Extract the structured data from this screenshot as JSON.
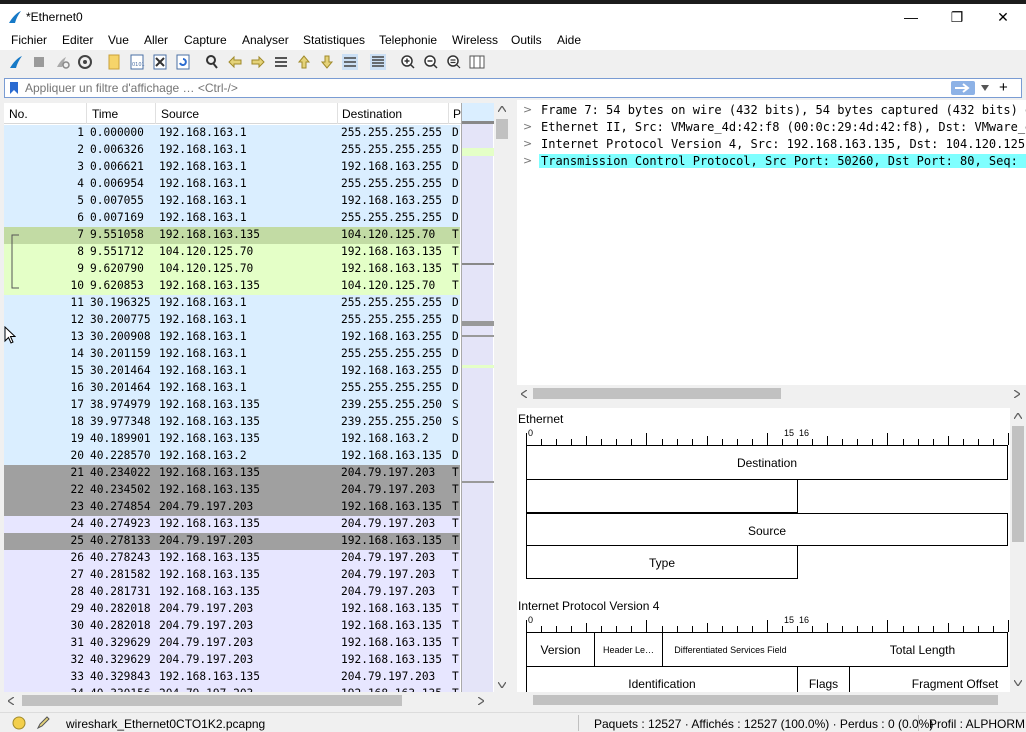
{
  "window": {
    "title": "*Ethernet0",
    "minimize": "—",
    "restore": "❐",
    "close": "✕"
  },
  "menu": [
    "Fichier",
    "Editer",
    "Vue",
    "Aller",
    "Capture",
    "Analyser",
    "Statistiques",
    "Telephonie",
    "Wireless",
    "Outils",
    "Aide"
  ],
  "filter": {
    "placeholder": "Appliquer un filtre d'affichage … <Ctrl-/>",
    "add": "+"
  },
  "columns": {
    "no": "No.",
    "time": "Time",
    "source": "Source",
    "destination": "Destination",
    "protocol": "P"
  },
  "packets": [
    {
      "no": "1",
      "time": "0.000000",
      "src": "192.168.163.1",
      "dst": "255.255.255.255",
      "proto": "D",
      "color": "#daeeff"
    },
    {
      "no": "2",
      "time": "0.006326",
      "src": "192.168.163.1",
      "dst": "255.255.255.255",
      "proto": "D",
      "color": "#daeeff"
    },
    {
      "no": "3",
      "time": "0.006621",
      "src": "192.168.163.1",
      "dst": "192.168.163.255",
      "proto": "D",
      "color": "#daeeff"
    },
    {
      "no": "4",
      "time": "0.006954",
      "src": "192.168.163.1",
      "dst": "255.255.255.255",
      "proto": "D",
      "color": "#daeeff"
    },
    {
      "no": "5",
      "time": "0.007055",
      "src": "192.168.163.1",
      "dst": "192.168.163.255",
      "proto": "D",
      "color": "#daeeff"
    },
    {
      "no": "6",
      "time": "0.007169",
      "src": "192.168.163.1",
      "dst": "255.255.255.255",
      "proto": "D",
      "color": "#daeeff"
    },
    {
      "no": "7",
      "time": "9.551058",
      "src": "192.168.163.135",
      "dst": "104.120.125.70",
      "proto": "T",
      "color": "#c2dba4"
    },
    {
      "no": "8",
      "time": "9.551712",
      "src": "104.120.125.70",
      "dst": "192.168.163.135",
      "proto": "T",
      "color": "#e4ffc7"
    },
    {
      "no": "9",
      "time": "9.620790",
      "src": "104.120.125.70",
      "dst": "192.168.163.135",
      "proto": "T",
      "color": "#e4ffc7"
    },
    {
      "no": "10",
      "time": "9.620853",
      "src": "192.168.163.135",
      "dst": "104.120.125.70",
      "proto": "T",
      "color": "#e4ffc7"
    },
    {
      "no": "11",
      "time": "30.196325",
      "src": "192.168.163.1",
      "dst": "255.255.255.255",
      "proto": "D",
      "color": "#daeeff"
    },
    {
      "no": "12",
      "time": "30.200775",
      "src": "192.168.163.1",
      "dst": "255.255.255.255",
      "proto": "D",
      "color": "#daeeff"
    },
    {
      "no": "13",
      "time": "30.200908",
      "src": "192.168.163.1",
      "dst": "192.168.163.255",
      "proto": "D",
      "color": "#daeeff"
    },
    {
      "no": "14",
      "time": "30.201159",
      "src": "192.168.163.1",
      "dst": "255.255.255.255",
      "proto": "D",
      "color": "#daeeff"
    },
    {
      "no": "15",
      "time": "30.201464",
      "src": "192.168.163.1",
      "dst": "192.168.163.255",
      "proto": "D",
      "color": "#daeeff"
    },
    {
      "no": "16",
      "time": "30.201464",
      "src": "192.168.163.1",
      "dst": "255.255.255.255",
      "proto": "D",
      "color": "#daeeff"
    },
    {
      "no": "17",
      "time": "38.974979",
      "src": "192.168.163.135",
      "dst": "239.255.255.250",
      "proto": "S",
      "color": "#daeeff"
    },
    {
      "no": "18",
      "time": "39.977348",
      "src": "192.168.163.135",
      "dst": "239.255.255.250",
      "proto": "S",
      "color": "#daeeff"
    },
    {
      "no": "19",
      "time": "40.189901",
      "src": "192.168.163.135",
      "dst": "192.168.163.2",
      "proto": "D",
      "color": "#daeeff"
    },
    {
      "no": "20",
      "time": "40.228570",
      "src": "192.168.163.2",
      "dst": "192.168.163.135",
      "proto": "D",
      "color": "#daeeff"
    },
    {
      "no": "21",
      "time": "40.234022",
      "src": "192.168.163.135",
      "dst": "204.79.197.203",
      "proto": "T",
      "color": "#a0a0a0"
    },
    {
      "no": "22",
      "time": "40.234502",
      "src": "192.168.163.135",
      "dst": "204.79.197.203",
      "proto": "T",
      "color": "#a0a0a0"
    },
    {
      "no": "23",
      "time": "40.274854",
      "src": "204.79.197.203",
      "dst": "192.168.163.135",
      "proto": "T",
      "color": "#a0a0a0"
    },
    {
      "no": "24",
      "time": "40.274923",
      "src": "192.168.163.135",
      "dst": "204.79.197.203",
      "proto": "T",
      "color": "#e7e6ff"
    },
    {
      "no": "25",
      "time": "40.278133",
      "src": "204.79.197.203",
      "dst": "192.168.163.135",
      "proto": "T",
      "color": "#a0a0a0"
    },
    {
      "no": "26",
      "time": "40.278243",
      "src": "192.168.163.135",
      "dst": "204.79.197.203",
      "proto": "T",
      "color": "#e7e6ff"
    },
    {
      "no": "27",
      "time": "40.281582",
      "src": "192.168.163.135",
      "dst": "204.79.197.203",
      "proto": "T",
      "color": "#e7e6ff"
    },
    {
      "no": "28",
      "time": "40.281731",
      "src": "192.168.163.135",
      "dst": "204.79.197.203",
      "proto": "T",
      "color": "#e7e6ff"
    },
    {
      "no": "29",
      "time": "40.282018",
      "src": "204.79.197.203",
      "dst": "192.168.163.135",
      "proto": "T",
      "color": "#e7e6ff"
    },
    {
      "no": "30",
      "time": "40.282018",
      "src": "204.79.197.203",
      "dst": "192.168.163.135",
      "proto": "T",
      "color": "#e7e6ff"
    },
    {
      "no": "31",
      "time": "40.329629",
      "src": "204.79.197.203",
      "dst": "192.168.163.135",
      "proto": "T",
      "color": "#e7e6ff"
    },
    {
      "no": "32",
      "time": "40.329629",
      "src": "204.79.197.203",
      "dst": "192.168.163.135",
      "proto": "T",
      "color": "#e7e6ff"
    },
    {
      "no": "33",
      "time": "40.329843",
      "src": "192.168.163.135",
      "dst": "204.79.197.203",
      "proto": "T",
      "color": "#e7e6ff"
    },
    {
      "no": "34",
      "time": "40.330156",
      "src": "204.79.197.203",
      "dst": "192.168.163.135",
      "proto": "T",
      "color": "#e7e6ff"
    }
  ],
  "details": [
    "Frame 7: 54 bytes on wire (432 bits), 54 bytes captured (432 bits) on",
    "Ethernet II, Src: VMware_4d:42:f8 (00:0c:29:4d:42:f8), Dst: VMware_ea",
    "Internet Protocol Version 4, Src: 192.168.163.135, Dst: 104.120.125.70",
    "Transmission Control Protocol, Src Port: 50260, Dst Port: 80, Seq: 1,"
  ],
  "diagram": {
    "ethernet_title": "Ethernet",
    "ethernet_fields": {
      "destination": "Destination",
      "source": "Source",
      "type": "Type"
    },
    "ip_title": "Internet Protocol Version 4",
    "ip_fields": {
      "version": "Version",
      "header_len": "Header Le…",
      "dsf": "Differentiated Services Field",
      "total_length": "Total Length",
      "identification": "Identification",
      "flags": "Flags",
      "fragment_offset": "Fragment Offset"
    },
    "ruler_labels": {
      "start": "0",
      "mid_a": "15",
      "mid_b": "16"
    }
  },
  "status": {
    "file": "wireshark_Ethernet0CTO1K2.pcapng",
    "packets": "Paquets : 12527 · Affichés : 12527 (100.0%) · Perdus : 0 (0.0%)",
    "profile": "Profil : ALPHORM"
  }
}
